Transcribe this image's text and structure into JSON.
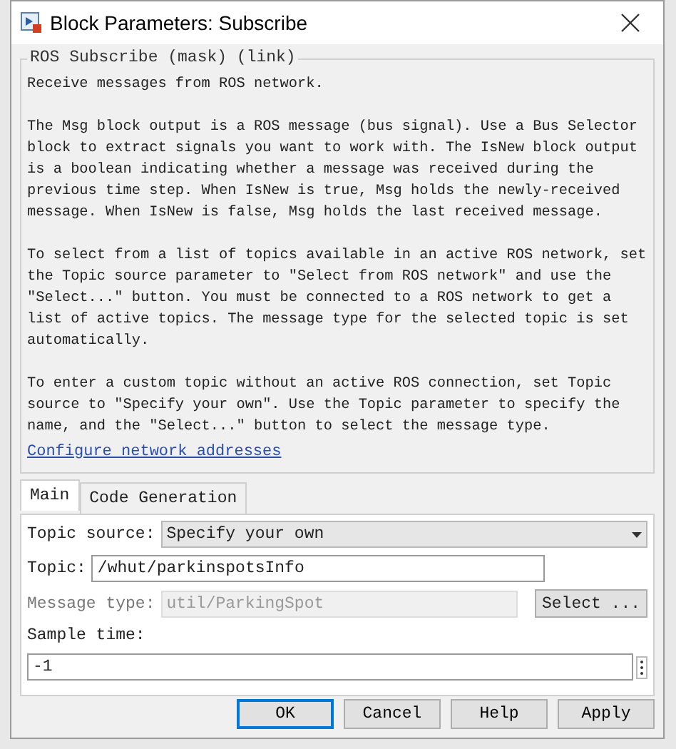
{
  "window": {
    "title": "Block Parameters: Subscribe"
  },
  "group": {
    "title": "ROS Subscribe (mask) (link)",
    "paragraphs": [
      "Receive messages from ROS network.",
      "The Msg block output is a ROS message (bus signal). Use a Bus Selector block to extract signals you want to work with. The IsNew block output is a boolean indicating whether a message was received during the previous time step. When IsNew is true, Msg holds the newly-received message. When IsNew is false, Msg holds the last received message.",
      "To select from a list of topics available in an active ROS network, set the Topic source parameter to \"Select from ROS network\" and use the \"Select...\" button. You must be connected to a ROS network to get a list of active topics. The message type for the selected topic is set automatically.",
      "To enter a custom topic without an active ROS connection, set Topic source to \"Specify your own\". Use the Topic parameter to specify the name, and the \"Select...\" button to select the message type."
    ],
    "link": "Configure network addresses"
  },
  "tabs": [
    {
      "label": "Main",
      "selected": true
    },
    {
      "label": "Code Generation",
      "selected": false
    }
  ],
  "params": {
    "topic_source": {
      "label": "Topic source:",
      "value": "Specify your own"
    },
    "topic": {
      "label": "Topic:",
      "value": "/whut/parkinspotsInfo"
    },
    "message_type": {
      "label": "Message type:",
      "value": "util/ParkingSpot",
      "disabled": true,
      "button": "Select ..."
    },
    "sample_time": {
      "label": "Sample time:",
      "value": "-1"
    }
  },
  "buttons": [
    {
      "label": "OK",
      "default": true
    },
    {
      "label": "Cancel",
      "default": false
    },
    {
      "label": "Help",
      "default": false
    },
    {
      "label": "Apply",
      "default": false
    }
  ]
}
